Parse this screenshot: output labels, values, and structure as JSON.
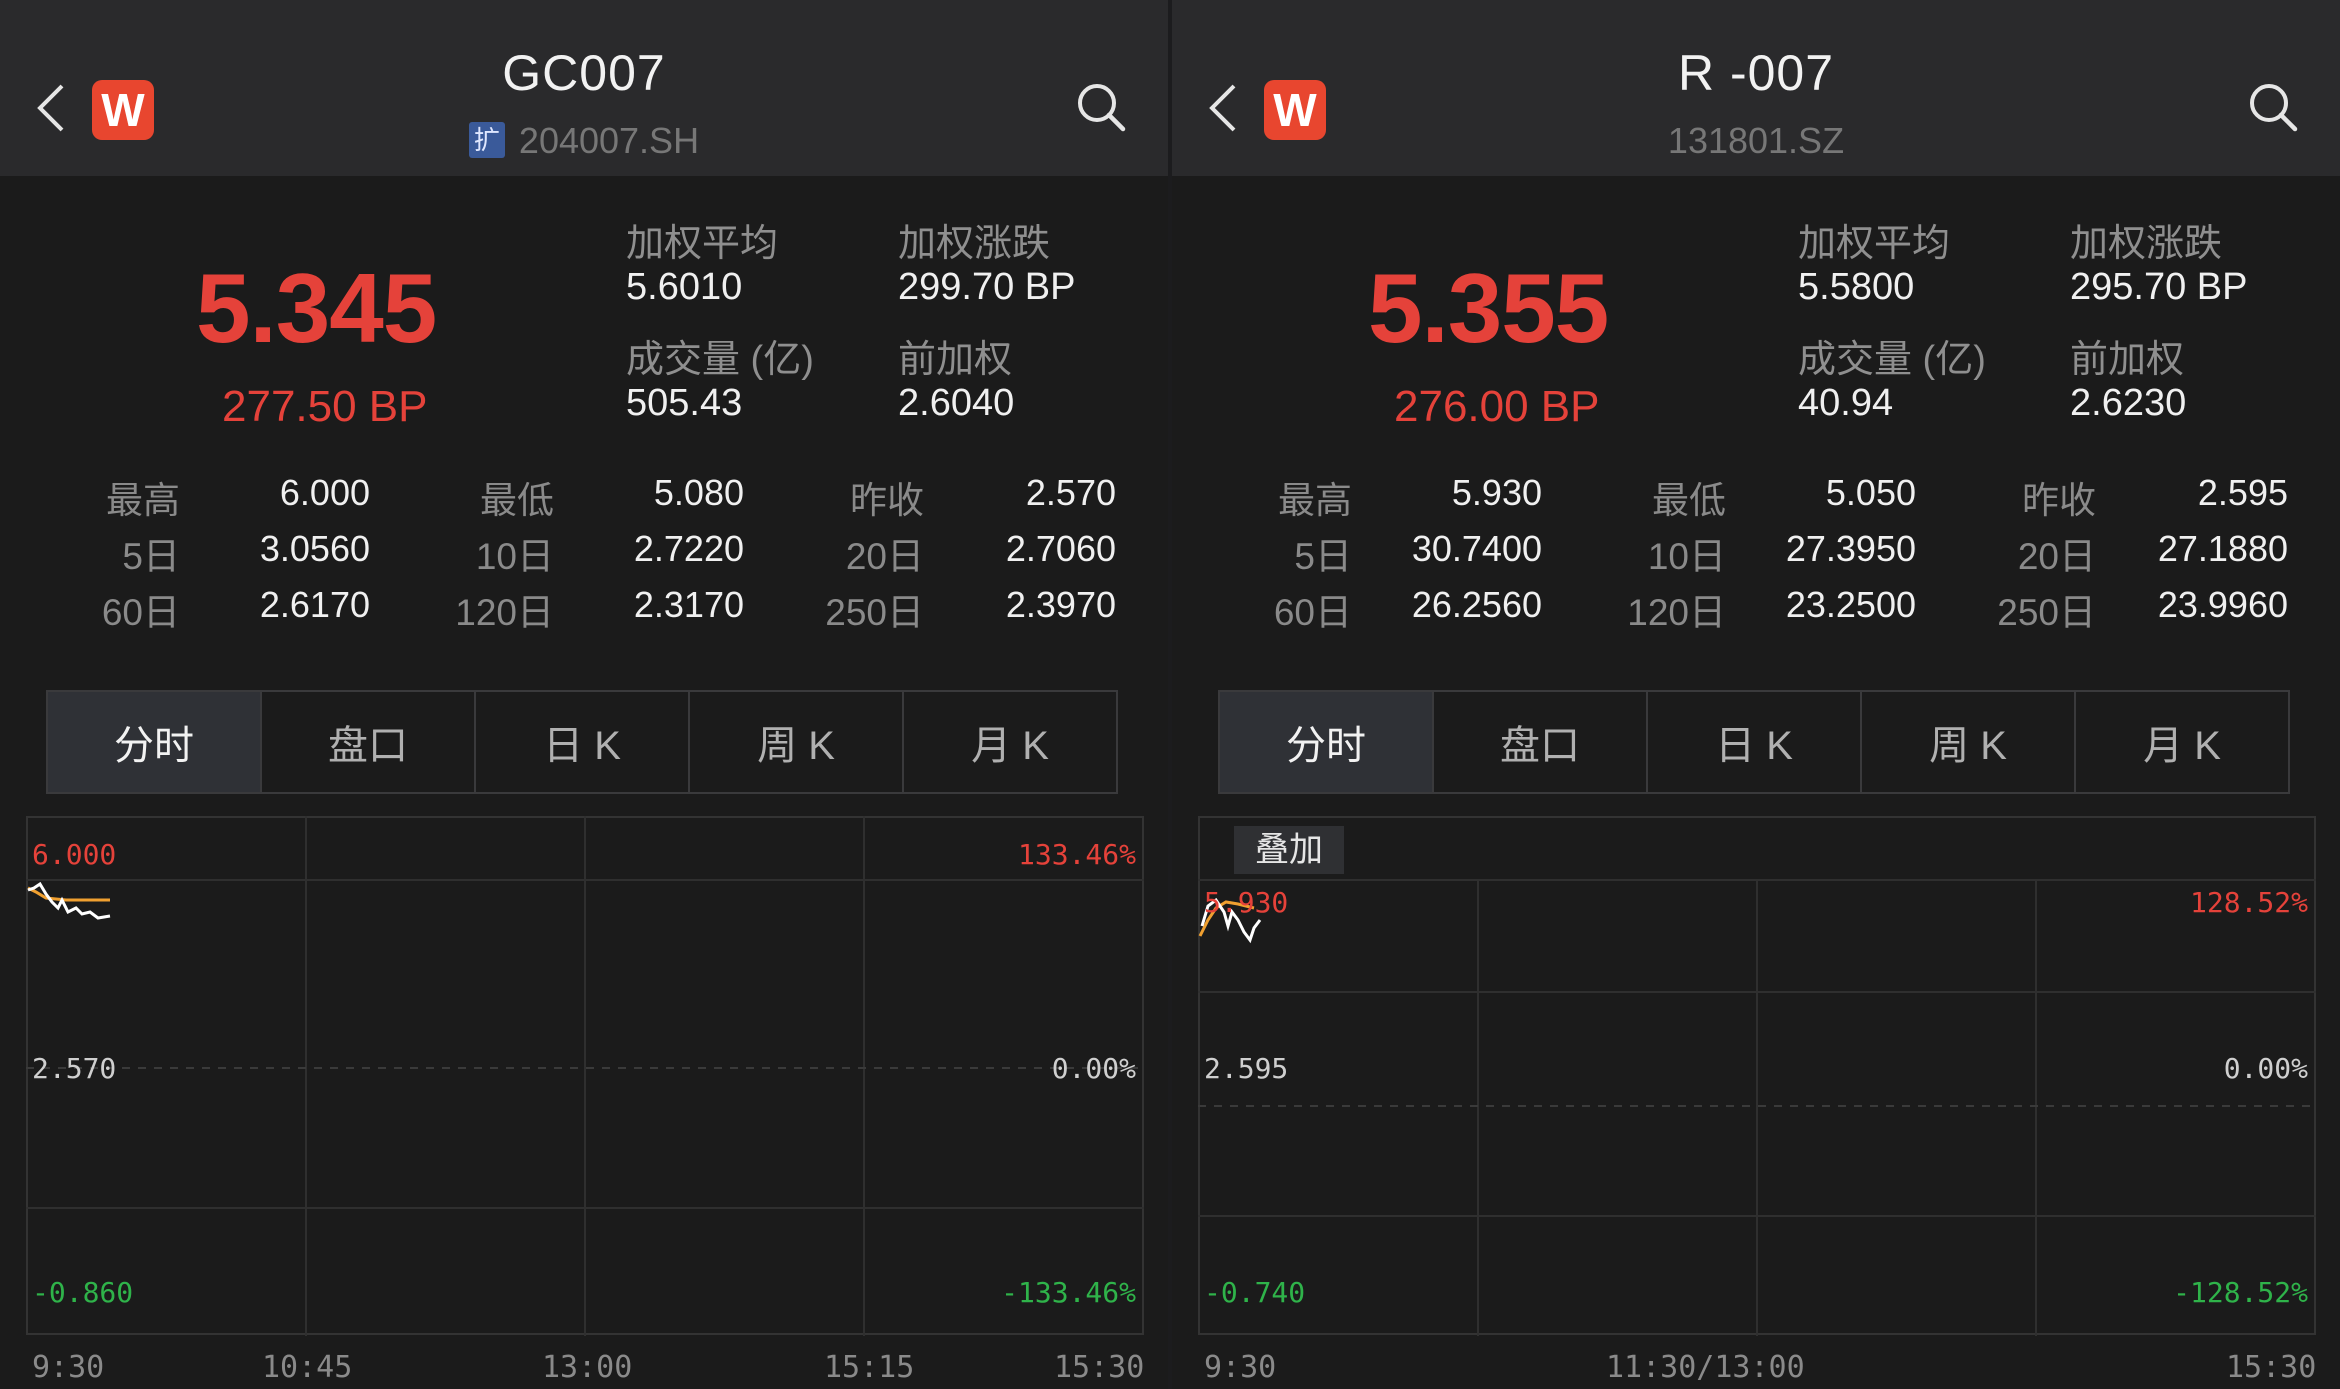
{
  "screens": [
    {
      "title": "GC007",
      "tag": "扩",
      "code": "204007.SH",
      "price": "5.345",
      "bp": "277.50 BP",
      "stats": {
        "wavg_label": "加权平均",
        "wavg": "5.6010",
        "wchg_label": "加权涨跌",
        "wchg": "299.70 BP",
        "vol_label": "成交量 (亿)",
        "vol": "505.43",
        "prev_label": "前加权",
        "prev": "2.6040"
      },
      "metrics": [
        {
          "label": "最高",
          "value": "6.000"
        },
        {
          "label": "最低",
          "value": "5.080"
        },
        {
          "label": "昨收",
          "value": "2.570"
        },
        {
          "label": "5日",
          "value": "3.0560"
        },
        {
          "label": "10日",
          "value": "2.7220"
        },
        {
          "label": "20日",
          "value": "2.7060"
        },
        {
          "label": "60日",
          "value": "2.6170"
        },
        {
          "label": "120日",
          "value": "2.3170"
        },
        {
          "label": "250日",
          "value": "2.3970"
        }
      ],
      "tabs": [
        "分时",
        "盘口",
        "日 K",
        "周 K",
        "月 K"
      ],
      "chart": {
        "y_top": "6.000",
        "y_mid": "2.570",
        "y_bot": "-0.860",
        "pct_top": "133.46%",
        "pct_mid": "0.00%",
        "pct_bot": "-133.46%",
        "x_labels": [
          "9:30",
          "10:45",
          "13:00",
          "15:15",
          "15:30"
        ]
      }
    },
    {
      "title": "R -007",
      "code": "131801.SZ",
      "price": "5.355",
      "bp": "276.00 BP",
      "stats": {
        "wavg_label": "加权平均",
        "wavg": "5.5800",
        "wchg_label": "加权涨跌",
        "wchg": "295.70 BP",
        "vol_label": "成交量 (亿)",
        "vol": "40.94",
        "prev_label": "前加权",
        "prev": "2.6230"
      },
      "metrics": [
        {
          "label": "最高",
          "value": "5.930"
        },
        {
          "label": "最低",
          "value": "5.050"
        },
        {
          "label": "昨收",
          "value": "2.595"
        },
        {
          "label": "5日",
          "value": "30.7400"
        },
        {
          "label": "10日",
          "value": "27.3950"
        },
        {
          "label": "20日",
          "value": "27.1880"
        },
        {
          "label": "60日",
          "value": "26.2560"
        },
        {
          "label": "120日",
          "value": "23.2500"
        },
        {
          "label": "250日",
          "value": "23.9960"
        }
      ],
      "tabs": [
        "分时",
        "盘口",
        "日 K",
        "周 K",
        "月 K"
      ],
      "chart": {
        "overlay": "叠加",
        "y_top": "5.930",
        "y_mid": "2.595",
        "y_bot": "-0.740",
        "pct_top": "128.52%",
        "pct_mid": "0.00%",
        "pct_bot": "-128.52%",
        "x_labels": [
          "9:30",
          "11:30/13:00",
          "15:30"
        ]
      }
    }
  ],
  "colors": {
    "up": "#e5423a",
    "down": "#2fb34a",
    "accent": "#e8462f",
    "price_line": "#ffffff",
    "avg_line": "#f0a030"
  },
  "icons": {
    "back": "chevron-left-icon",
    "logo": "w-logo-icon",
    "search": "search-icon"
  }
}
